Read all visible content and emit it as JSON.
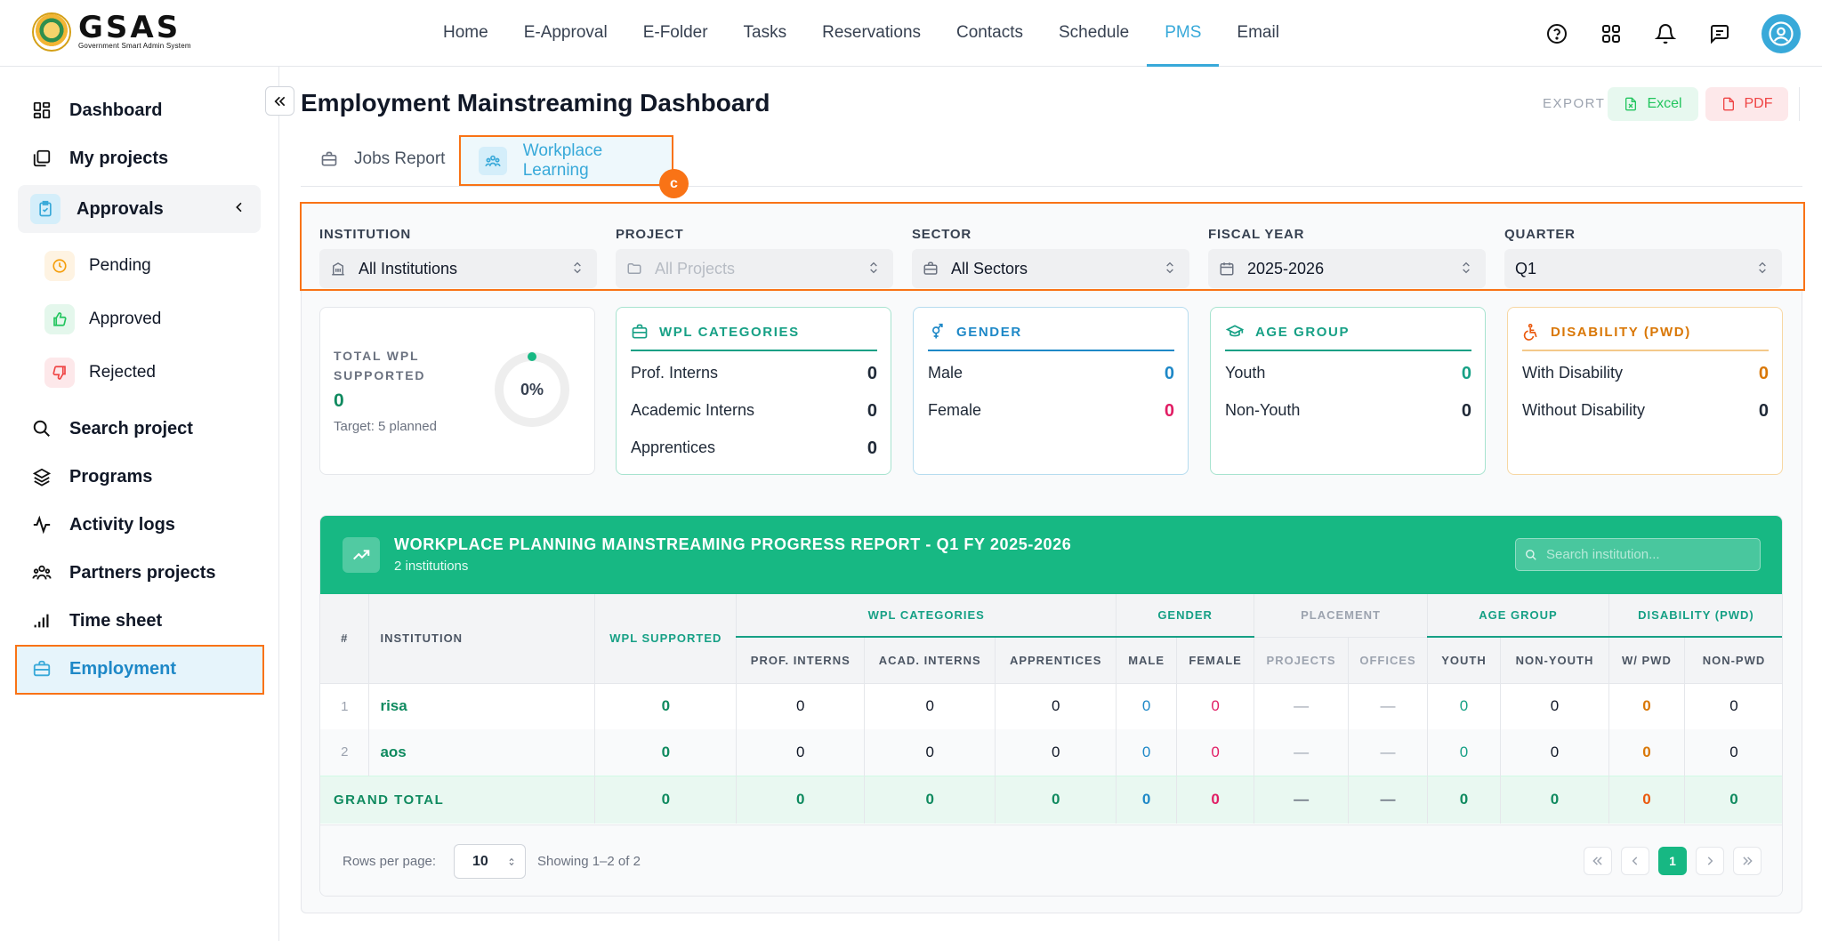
{
  "brand": {
    "name": "GSAS",
    "tagline": "Government Smart Admin System"
  },
  "nav": [
    {
      "label": "Home",
      "active": false
    },
    {
      "label": "E-Approval",
      "active": false
    },
    {
      "label": "E-Folder",
      "active": false
    },
    {
      "label": "Tasks",
      "active": false
    },
    {
      "label": "Reservations",
      "active": false
    },
    {
      "label": "Contacts",
      "active": false
    },
    {
      "label": "Schedule",
      "active": false
    },
    {
      "label": "PMS",
      "active": true
    },
    {
      "label": "Email",
      "active": false
    }
  ],
  "top_icons": [
    "help-icon",
    "apps-grid-icon",
    "bell-icon",
    "chat-icon",
    "user-avatar-icon"
  ],
  "sidebar": {
    "items": [
      {
        "label": "Dashboard",
        "icon": "dashboard-icon"
      },
      {
        "label": "My projects",
        "icon": "projects-icon"
      },
      {
        "label": "Approvals",
        "icon": "clipboard-check-icon",
        "expanded": true
      },
      {
        "label": "Search project",
        "icon": "search-icon"
      },
      {
        "label": "Programs",
        "icon": "layers-icon"
      },
      {
        "label": "Activity logs",
        "icon": "activity-icon"
      },
      {
        "label": "Partners projects",
        "icon": "partners-icon"
      },
      {
        "label": "Time sheet",
        "icon": "bar-chart-icon"
      },
      {
        "label": "Employment",
        "icon": "briefcase-icon",
        "active": true
      }
    ],
    "approvals_sub": [
      {
        "label": "Pending",
        "icon": "clock-icon"
      },
      {
        "label": "Approved",
        "icon": "thumbs-up-icon"
      },
      {
        "label": "Rejected",
        "icon": "thumbs-down-icon"
      }
    ]
  },
  "page": {
    "title": "Employment Mainstreaming Dashboard",
    "export_label": "EXPORT",
    "excel_label": "Excel",
    "pdf_label": "PDF"
  },
  "tabs": [
    {
      "label": "Jobs Report",
      "active": false
    },
    {
      "label": "Workplace Learning",
      "active": true
    }
  ],
  "annotation_badge": "c",
  "filters": [
    {
      "label": "INSTITUTION",
      "value": "All Institutions",
      "icon": "building-icon",
      "disabled": false
    },
    {
      "label": "PROJECT",
      "value": "All Projects",
      "icon": "folder-icon",
      "disabled": true
    },
    {
      "label": "SECTOR",
      "value": "All Sectors",
      "icon": "briefcase-icon",
      "disabled": false
    },
    {
      "label": "FISCAL YEAR",
      "value": "2025-2026",
      "icon": "calendar-icon",
      "disabled": false
    },
    {
      "label": "QUARTER",
      "value": "Q1",
      "icon": "",
      "disabled": false
    }
  ],
  "total_card": {
    "label": "TOTAL WPL SUPPORTED",
    "value": "0",
    "target": "Target: 5 planned",
    "progress_text": "0%",
    "progress": 0
  },
  "cards": [
    {
      "title": "WPL CATEGORIES",
      "color": "#16a085",
      "icon": "briefcase-icon",
      "rows": [
        {
          "label": "Prof. Interns",
          "value": "0"
        },
        {
          "label": "Academic Interns",
          "value": "0"
        },
        {
          "label": "Apprentices",
          "value": "0"
        }
      ]
    },
    {
      "title": "GENDER",
      "color": "#1e88c7",
      "icon": "gender-icon",
      "rows": [
        {
          "label": "Male",
          "value": "0"
        },
        {
          "label": "Female",
          "value": "0"
        }
      ]
    },
    {
      "title": "AGE GROUP",
      "color": "#16a085",
      "icon": "graduation-cap-icon",
      "rows": [
        {
          "label": "Youth",
          "value": "0"
        },
        {
          "label": "Non-Youth",
          "value": "0"
        }
      ]
    },
    {
      "title": "DISABILITY (PWD)",
      "color": "#d97706",
      "icon": "wheelchair-icon",
      "rows": [
        {
          "label": "With Disability",
          "value": "0"
        },
        {
          "label": "Without Disability",
          "value": "0"
        }
      ]
    }
  ],
  "report": {
    "title": "WORKPLACE PLANNING MAINSTREAMING PROGRESS REPORT - Q1 FY 2025-2026",
    "subtitle": "2 institutions",
    "search_placeholder": "Search institution...",
    "group_headers": {
      "num": "#",
      "institution": "INSTITUTION",
      "wpl_supported": "WPL SUPPORTED",
      "wpl_categories": "WPL CATEGORIES",
      "gender": "GENDER",
      "placement": "PLACEMENT",
      "age_group": "AGE GROUP",
      "disability": "DISABILITY (PWD)"
    },
    "sub_headers": [
      "PROF. INTERNS",
      "ACAD. INTERNS",
      "APPRENTICES",
      "MALE",
      "FEMALE",
      "PROJECTS",
      "OFFICES",
      "YOUTH",
      "NON-YOUTH",
      "W/ PWD",
      "NON-PWD"
    ],
    "rows": [
      {
        "num": "1",
        "institution": "risa",
        "wpl": "0",
        "prof": "0",
        "acad": "0",
        "appr": "0",
        "male": "0",
        "female": "0",
        "projects": "—",
        "offices": "—",
        "youth": "0",
        "nonyouth": "0",
        "pwd": "0",
        "nonpwd": "0"
      },
      {
        "num": "2",
        "institution": "aos",
        "wpl": "0",
        "prof": "0",
        "acad": "0",
        "appr": "0",
        "male": "0",
        "female": "0",
        "projects": "—",
        "offices": "—",
        "youth": "0",
        "nonyouth": "0",
        "pwd": "0",
        "nonpwd": "0"
      }
    ],
    "total": {
      "label": "GRAND TOTAL",
      "wpl": "0",
      "prof": "0",
      "acad": "0",
      "appr": "0",
      "male": "0",
      "female": "0",
      "projects": "—",
      "offices": "—",
      "youth": "0",
      "nonyouth": "0",
      "pwd": "0",
      "nonpwd": "0"
    },
    "footer": {
      "rows_per_page_label": "Rows per page:",
      "rows_per_page": "10",
      "showing": "Showing 1–2 of 2",
      "current_page": "1"
    }
  },
  "colors": {
    "accent": "#38a9d9",
    "green": "#17b883",
    "highlight": "#f97316"
  }
}
